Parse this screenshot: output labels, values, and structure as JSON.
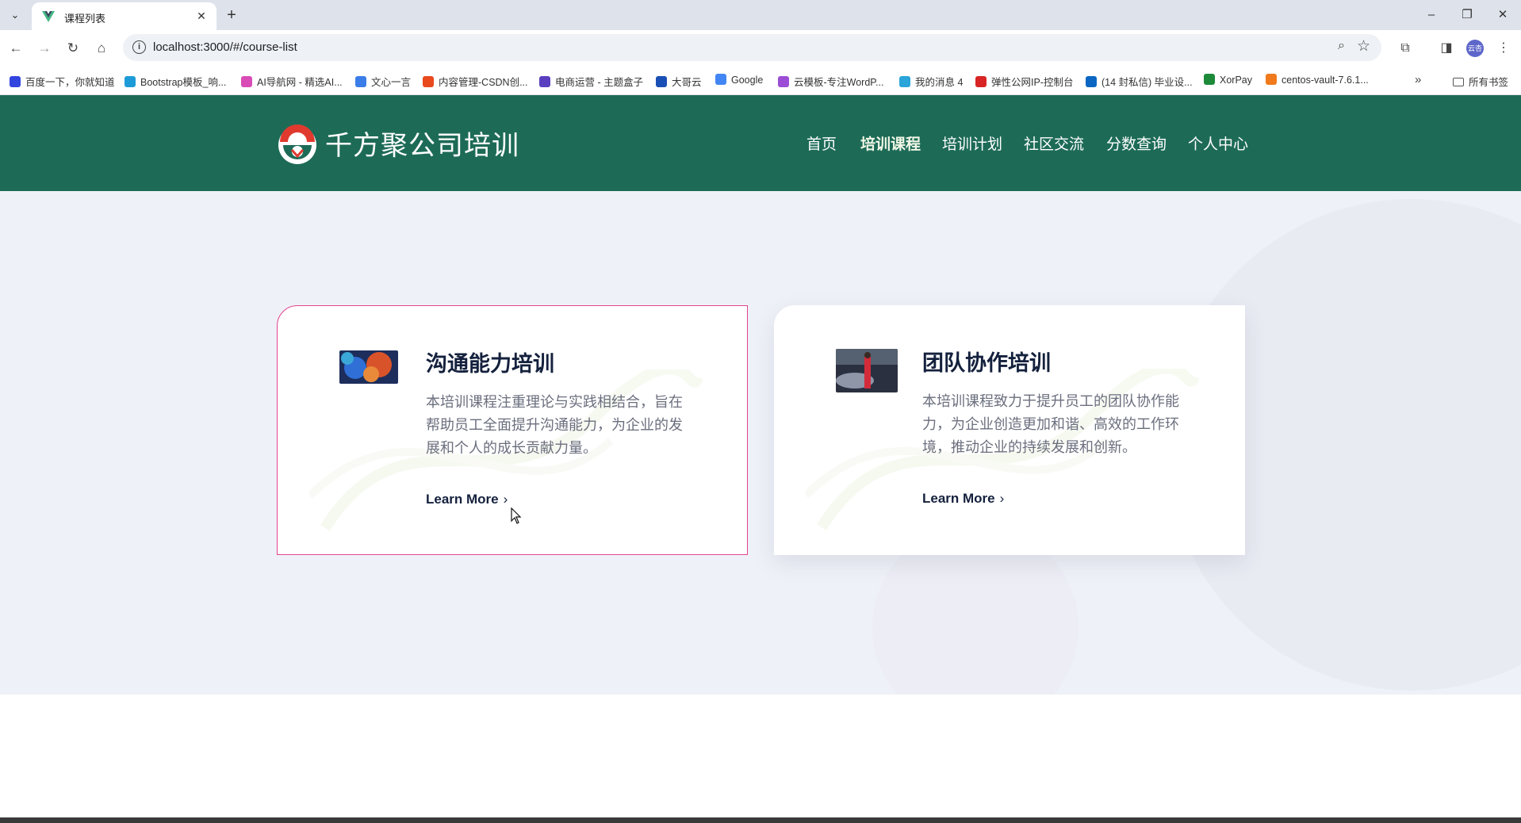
{
  "browser": {
    "tab_title": "课程列表",
    "new_tab": "+",
    "url": "localhost:3000/#/course-list",
    "profile_initials": "云杏",
    "bookmarks": [
      {
        "label": "百度一下，你就知道",
        "color": "#3245df"
      },
      {
        "label": "Bootstrap模板_响...",
        "color": "#1d9bd8"
      },
      {
        "label": "AI导航网 - 精选AI...",
        "color": "#d94bb6"
      },
      {
        "label": "文心一言",
        "color": "#3b7de8"
      },
      {
        "label": "内容管理-CSDN创...",
        "color": "#e8491d"
      },
      {
        "label": "电商运营 - 主题盒子",
        "color": "#5a3fc0"
      },
      {
        "label": "大哥云",
        "color": "#1a4fb5"
      },
      {
        "label": "Google",
        "color": "#4285f4"
      },
      {
        "label": "云模板-专注WordP...",
        "color": "#9b4dd6"
      },
      {
        "label": "我的消息 4",
        "color": "#2aa4d9"
      },
      {
        "label": "弹性公网IP-控制台",
        "color": "#d82424"
      },
      {
        "label": "(14 封私信) 毕业设...",
        "color": "#0a66c2"
      },
      {
        "label": "XorPay",
        "color": "#1d8a3a"
      },
      {
        "label": "centos-vault-7.6.1...",
        "color": "#f07a1c"
      }
    ],
    "bookmarks_more": "»",
    "all_bookmarks": "所有书签"
  },
  "site": {
    "brand": "千方聚公司培训",
    "nav": [
      {
        "label": "首页",
        "active": false
      },
      {
        "label": "培训课程",
        "active": true
      },
      {
        "label": "培训计划",
        "active": false
      },
      {
        "label": "社区交流",
        "active": false
      },
      {
        "label": "分数查询",
        "active": false
      },
      {
        "label": "个人中心",
        "active": false
      }
    ]
  },
  "courses": [
    {
      "title": "沟通能力培训",
      "description": "本培训课程注重理论与实践相结合，旨在帮助员工全面提升沟通能力，为企业的发展和个人的成长贡献力量。",
      "link": "Learn More",
      "thumb_icon": "abstract-image"
    },
    {
      "title": "团队协作培训",
      "description": "本培训课程致力于提升员工的团队协作能力，为企业创造更加和谐、高效的工作环境，推动企业的持续发展和创新。",
      "link": "Learn More",
      "thumb_icon": "person-car-image"
    }
  ],
  "colors": {
    "header_bg": "#1d6b57",
    "main_bg": "#eff1f8",
    "active_card_border": "#e2458f",
    "title_color": "#14213d"
  }
}
